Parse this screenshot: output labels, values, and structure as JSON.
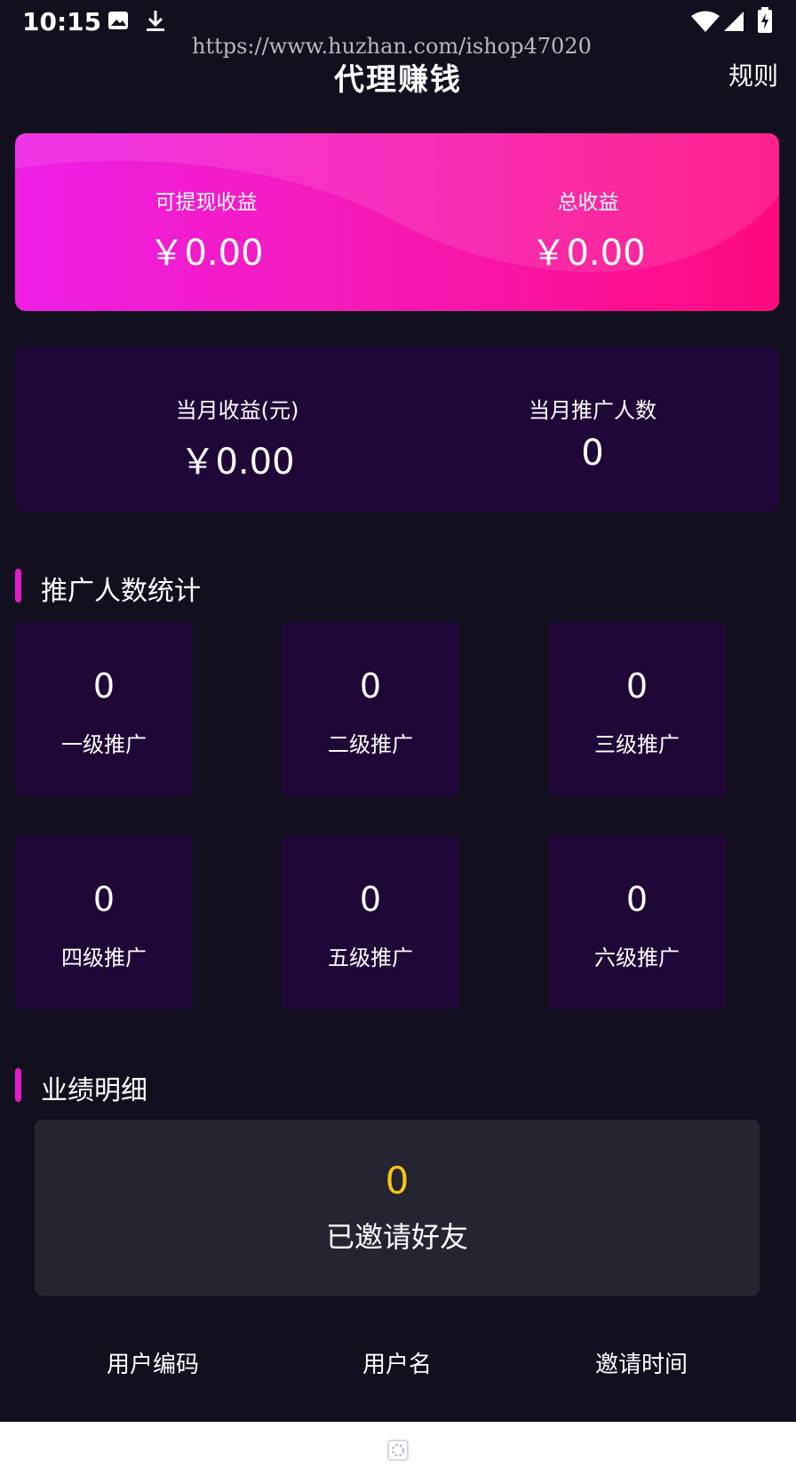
{
  "status_bar": {
    "time": "10:15",
    "icons": [
      "image-icon",
      "download-icon",
      "wifi-icon",
      "signal-icon",
      "battery-charging-icon"
    ]
  },
  "watermark": "https://www.huzhan.com/ishop47020",
  "nav": {
    "title": "代理赚钱",
    "rule_label": "规则"
  },
  "earnings": {
    "withdrawable_label": "可提现收益",
    "withdrawable_value": "￥0.00",
    "total_label": "总收益",
    "total_value": "￥0.00"
  },
  "monthly": {
    "income_label": "当月收益(元)",
    "income_value": "￥0.00",
    "promoters_label": "当月推广人数",
    "promoters_value": "0"
  },
  "promo_stats": {
    "title": "推广人数统计",
    "levels": [
      {
        "count": "0",
        "label": "一级推广"
      },
      {
        "count": "0",
        "label": "二级推广"
      },
      {
        "count": "0",
        "label": "三级推广"
      },
      {
        "count": "0",
        "label": "四级推广"
      },
      {
        "count": "0",
        "label": "五级推广"
      },
      {
        "count": "0",
        "label": "六级推广"
      }
    ]
  },
  "performance": {
    "title": "业绩明细",
    "invited_count": "0",
    "invited_label": "已邀请好友",
    "columns": [
      "用户编码",
      "用户名",
      "邀请时间"
    ]
  },
  "colors": {
    "background": "#12101f",
    "card_purple": "#1f0838",
    "accent_pink": "#e51ac8",
    "invite_number": "#f5c518"
  }
}
